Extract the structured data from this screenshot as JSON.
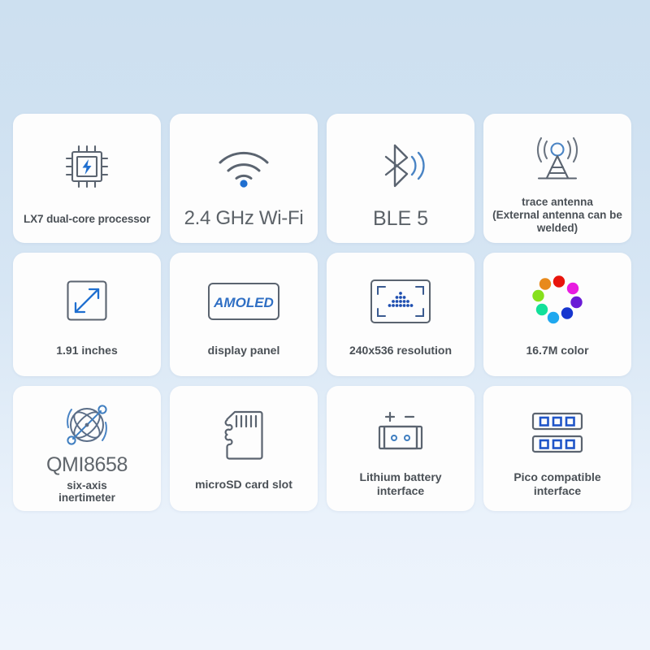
{
  "page": {
    "background_top_color": "#cde0f0",
    "background_bottom_color": "#eef4fc",
    "card_background": "#fdfdfd",
    "icon_stroke_color": "#5b6470",
    "icon_accent_color": "#1f6fd0"
  },
  "cards": [
    {
      "id": "lx7-processor",
      "icon": "chip-icon",
      "label": "LX7 dual-core processor",
      "label_style": "small"
    },
    {
      "id": "wifi",
      "icon": "wifi-icon",
      "label": "2.4 GHz Wi-Fi",
      "label_style": "large"
    },
    {
      "id": "ble",
      "icon": "bluetooth-icon",
      "label": "BLE 5",
      "label_style": "large"
    },
    {
      "id": "trace-antenna",
      "icon": "antenna-icon",
      "label": "trace antenna",
      "label_line2": "(External antenna can be",
      "label_line3": "welded)",
      "label_style": "small"
    },
    {
      "id": "screen-size",
      "icon": "diagonal-arrow-icon",
      "label": "1.91 inches",
      "label_style": "medium"
    },
    {
      "id": "display-panel",
      "icon": "amoled-icon",
      "icon_text": "AMOLED",
      "label": "display panel",
      "label_style": "medium"
    },
    {
      "id": "resolution",
      "icon": "resolution-icon",
      "label": "240x536 resolution",
      "label_style": "medium"
    },
    {
      "id": "color-depth",
      "icon": "color-wheel-icon",
      "label": "16.7M color",
      "label_style": "medium"
    },
    {
      "id": "imu",
      "icon": "gyroscope-icon",
      "label": "QMI8658",
      "label_line2": "six-axis",
      "label_line3": "inertimeter",
      "label_style": "qmi"
    },
    {
      "id": "microsd",
      "icon": "microsd-card-icon",
      "label": "microSD card slot",
      "label_style": "medium"
    },
    {
      "id": "battery",
      "icon": "battery-connector-icon",
      "label": "Lithium battery",
      "label_line2": "interface",
      "label_style": "medium"
    },
    {
      "id": "pico",
      "icon": "pin-header-icon",
      "label": "Pico compatible",
      "label_line2": "interface",
      "label_style": "medium"
    }
  ],
  "color_wheel": {
    "dots": [
      {
        "name": "red",
        "hex": "#e8140c"
      },
      {
        "name": "magenta",
        "hex": "#e81ce0"
      },
      {
        "name": "violet",
        "hex": "#6a1ad6"
      },
      {
        "name": "blue",
        "hex": "#1736cf"
      },
      {
        "name": "cyan",
        "hex": "#1fa8ef"
      },
      {
        "name": "spring-green",
        "hex": "#12e09a"
      },
      {
        "name": "green-yellow",
        "hex": "#86e01c"
      },
      {
        "name": "orange",
        "hex": "#e88a1c"
      }
    ]
  }
}
